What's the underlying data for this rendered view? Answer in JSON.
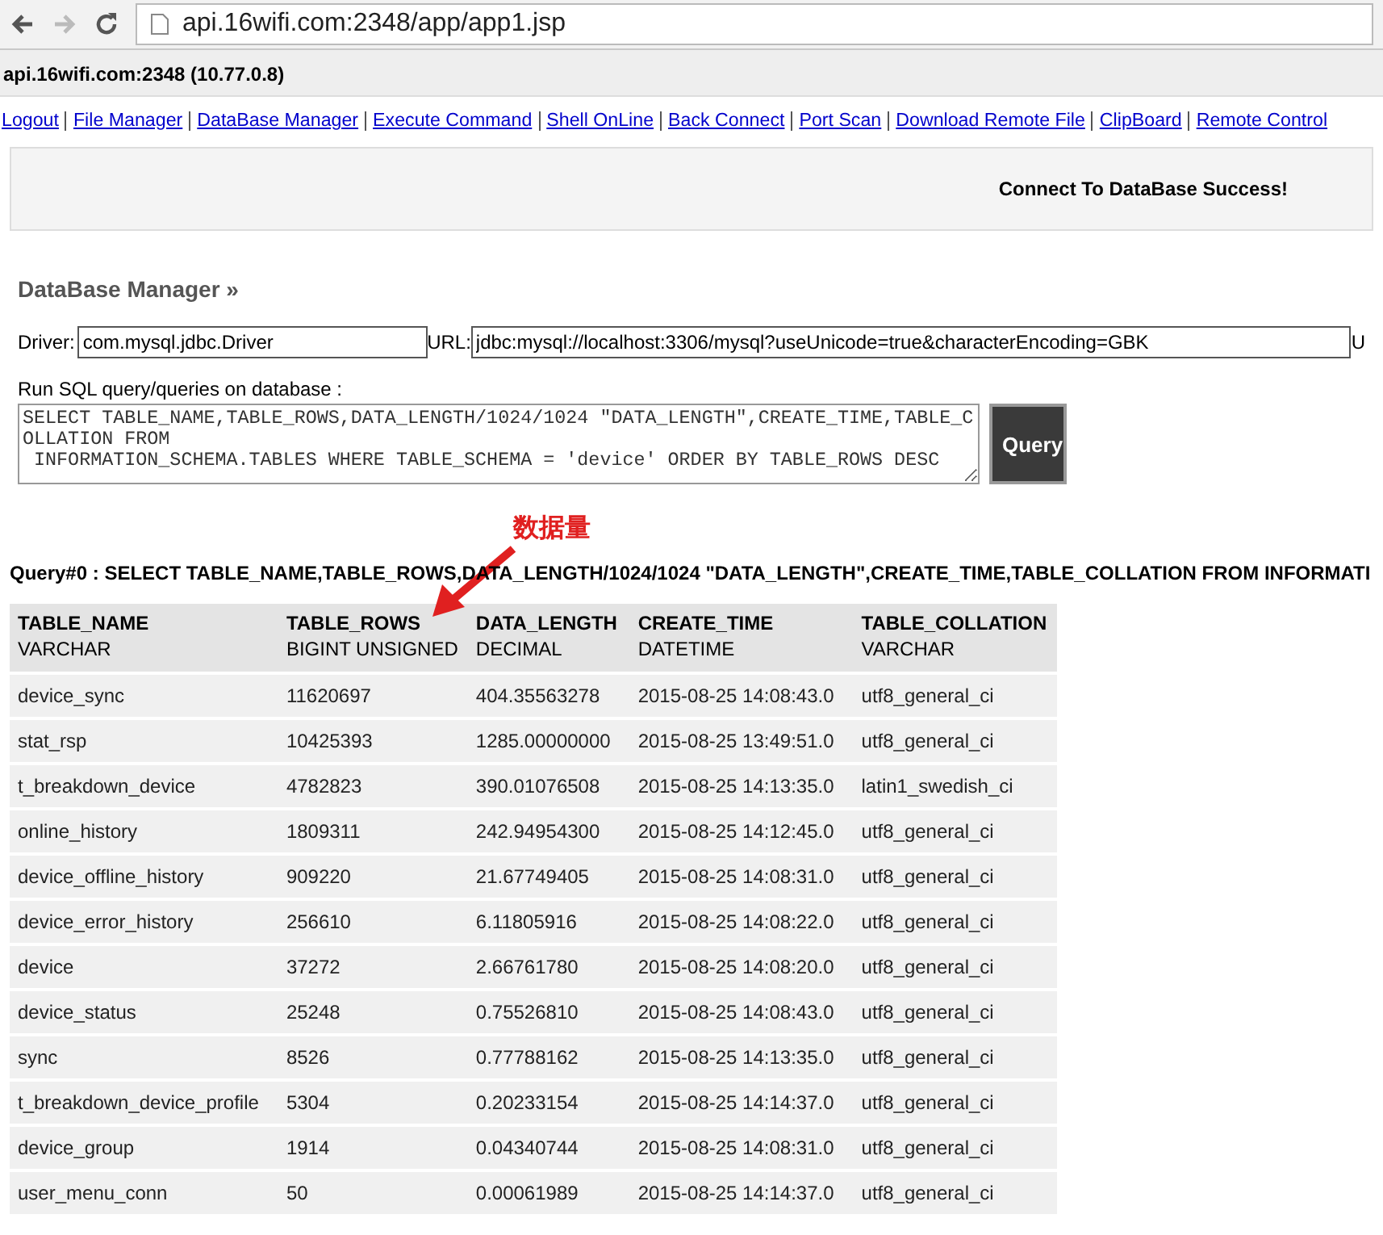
{
  "browser": {
    "address": "api.16wifi.com:2348/app/app1.jsp"
  },
  "header": {
    "host": "api.16wifi.com:2348 (10.77.0.8)"
  },
  "nav": [
    "Logout",
    "File Manager",
    "DataBase Manager",
    "Execute Command",
    "Shell OnLine",
    "Back Connect",
    "Port Scan",
    "Download Remote File",
    "ClipBoard",
    "Remote Control"
  ],
  "status_message": "Connect To DataBase Success!",
  "section_title": "DataBase Manager »",
  "connection": {
    "driver_label": "Driver:",
    "driver": "com.mysql.jdbc.Driver",
    "url_label": "URL:",
    "url": "jdbc:mysql://localhost:3306/mysql?useUnicode=true&characterEncoding=GBK",
    "cut_label": "U"
  },
  "sql": {
    "label": "Run SQL query/queries on database :",
    "query": "SELECT TABLE_NAME,TABLE_ROWS,DATA_LENGTH/1024/1024 \"DATA_LENGTH\",CREATE_TIME,TABLE_COLLATION FROM\n INFORMATION_SCHEMA.TABLES WHERE TABLE_SCHEMA = 'device' ORDER BY TABLE_ROWS DESC",
    "button": "Query"
  },
  "annotation": {
    "text": "数据量"
  },
  "query_line": "Query#0 : SELECT TABLE_NAME,TABLE_ROWS,DATA_LENGTH/1024/1024 \"DATA_LENGTH\",CREATE_TIME,TABLE_COLLATION FROM INFORMATI",
  "table": {
    "columns": [
      {
        "name": "TABLE_NAME",
        "type": "VARCHAR"
      },
      {
        "name": "TABLE_ROWS",
        "type": "BIGINT UNSIGNED"
      },
      {
        "name": "DATA_LENGTH",
        "type": "DECIMAL"
      },
      {
        "name": "CREATE_TIME",
        "type": "DATETIME"
      },
      {
        "name": "TABLE_COLLATION",
        "type": "VARCHAR"
      }
    ],
    "rows": [
      [
        "device_sync",
        "11620697",
        "404.35563278",
        "2015-08-25 14:08:43.0",
        "utf8_general_ci"
      ],
      [
        "stat_rsp",
        "10425393",
        "1285.00000000",
        "2015-08-25 13:49:51.0",
        "utf8_general_ci"
      ],
      [
        "t_breakdown_device",
        "4782823",
        "390.01076508",
        "2015-08-25 14:13:35.0",
        "latin1_swedish_ci"
      ],
      [
        "online_history",
        "1809311",
        "242.94954300",
        "2015-08-25 14:12:45.0",
        "utf8_general_ci"
      ],
      [
        "device_offline_history",
        "909220",
        "21.67749405",
        "2015-08-25 14:08:31.0",
        "utf8_general_ci"
      ],
      [
        "device_error_history",
        "256610",
        "6.11805916",
        "2015-08-25 14:08:22.0",
        "utf8_general_ci"
      ],
      [
        "device",
        "37272",
        "2.66761780",
        "2015-08-25 14:08:20.0",
        "utf8_general_ci"
      ],
      [
        "device_status",
        "25248",
        "0.75526810",
        "2015-08-25 14:08:43.0",
        "utf8_general_ci"
      ],
      [
        "sync",
        "8526",
        "0.77788162",
        "2015-08-25 14:13:35.0",
        "utf8_general_ci"
      ],
      [
        "t_breakdown_device_profile",
        "5304",
        "0.20233154",
        "2015-08-25 14:14:37.0",
        "utf8_general_ci"
      ],
      [
        "device_group",
        "1914",
        "0.04340744",
        "2015-08-25 14:08:31.0",
        "utf8_general_ci"
      ],
      [
        "user_menu_conn",
        "50",
        "0.00061989",
        "2015-08-25 14:14:37.0",
        "utf8_general_ci"
      ]
    ]
  }
}
